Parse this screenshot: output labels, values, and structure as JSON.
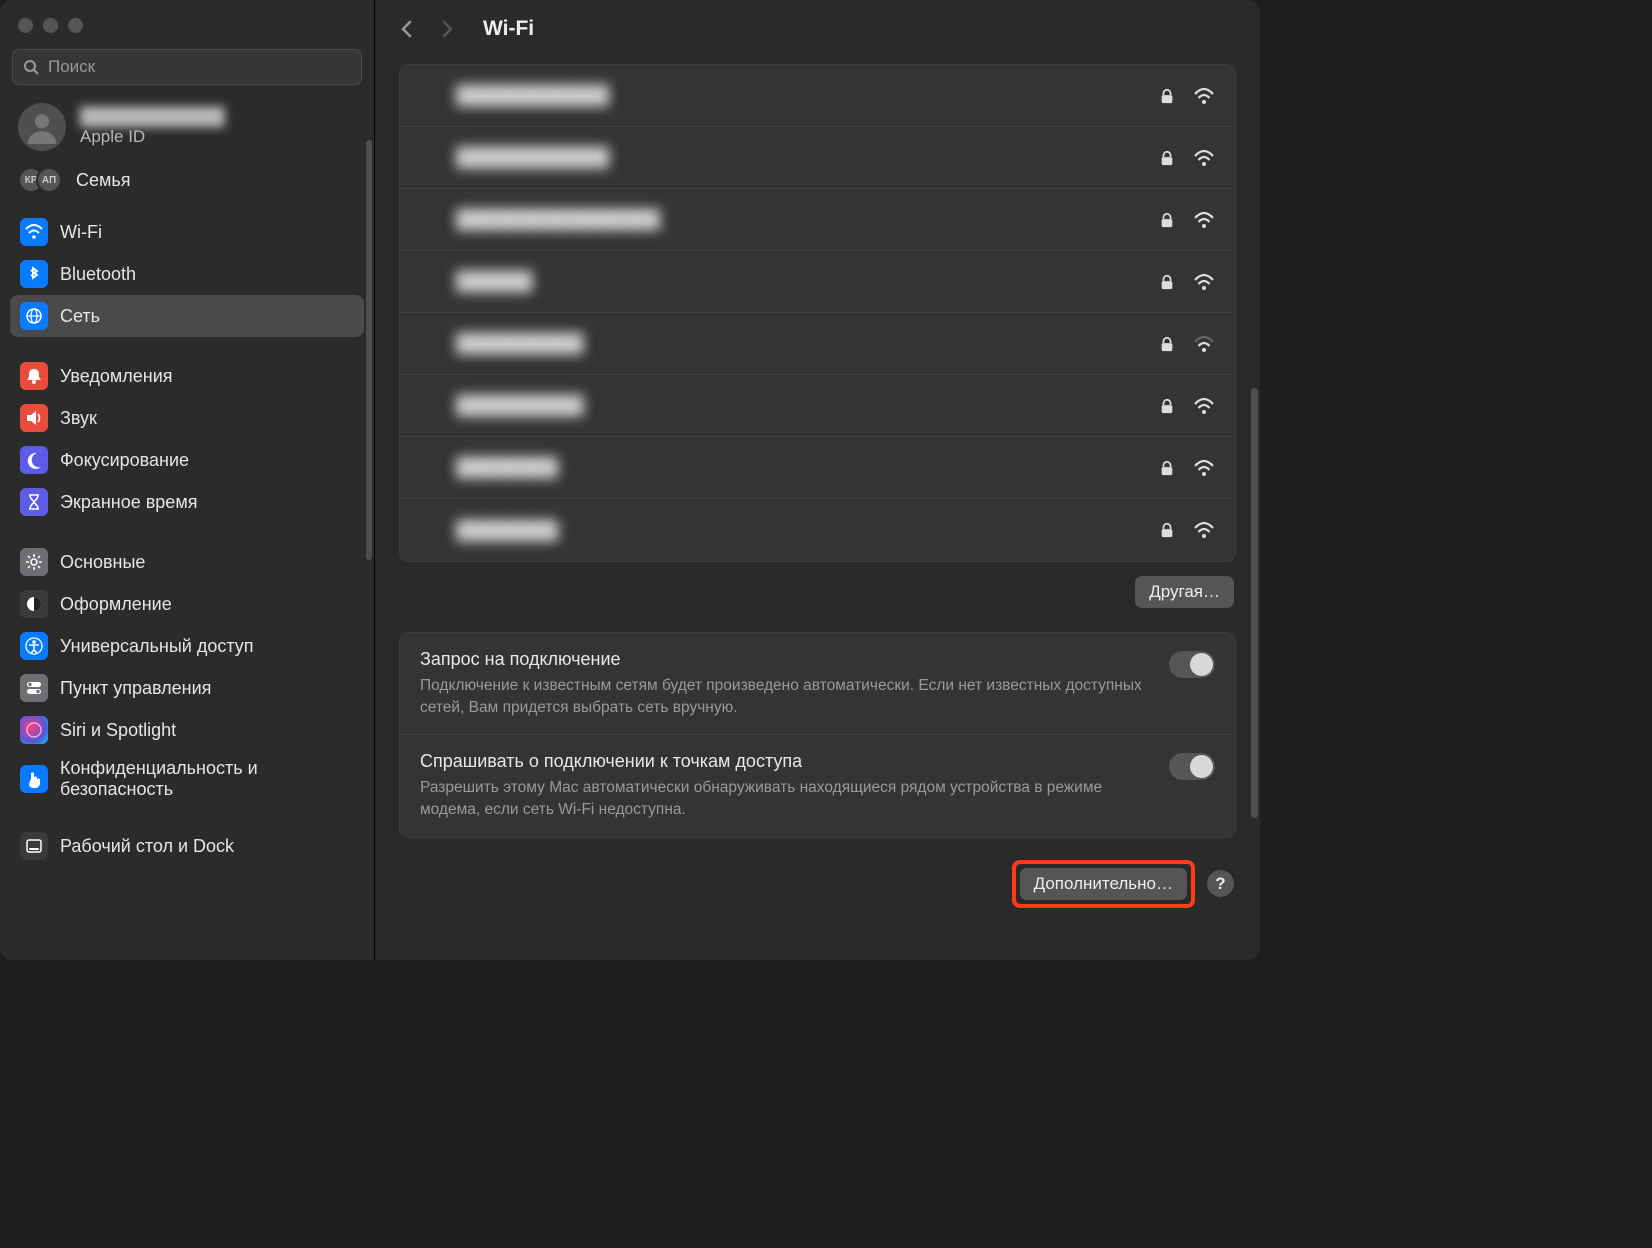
{
  "traffic_lights": [
    "close",
    "minimize",
    "zoom"
  ],
  "search": {
    "placeholder": "Поиск"
  },
  "account": {
    "name": "████████████",
    "sub": "Apple ID"
  },
  "family": {
    "badges": [
      "КР",
      "АП"
    ],
    "label": "Семья"
  },
  "sidebar": {
    "group1": [
      {
        "id": "wifi",
        "label": "Wi-Fi",
        "icon": "wifi",
        "color": "ic-blue"
      },
      {
        "id": "bluetooth",
        "label": "Bluetooth",
        "icon": "bluetooth",
        "color": "ic-blue"
      },
      {
        "id": "network",
        "label": "Сеть",
        "icon": "globe",
        "color": "ic-blue",
        "selected": true
      }
    ],
    "group2": [
      {
        "id": "notifications",
        "label": "Уведомления",
        "icon": "bell",
        "color": "ic-red"
      },
      {
        "id": "sound",
        "label": "Звук",
        "icon": "speaker",
        "color": "ic-red"
      },
      {
        "id": "focus",
        "label": "Фокусирование",
        "icon": "moon",
        "color": "ic-purple"
      },
      {
        "id": "screentime",
        "label": "Экранное время",
        "icon": "hourglass",
        "color": "ic-purple"
      }
    ],
    "group3": [
      {
        "id": "general",
        "label": "Основные",
        "icon": "gear",
        "color": "ic-gray"
      },
      {
        "id": "appearance",
        "label": "Оформление",
        "icon": "appearance",
        "color": "ic-dark"
      },
      {
        "id": "accessibility",
        "label": "Универсальный доступ",
        "icon": "accessibility",
        "color": "ic-cyan"
      },
      {
        "id": "controlcenter",
        "label": "Пункт управления",
        "icon": "switches",
        "color": "ic-gray"
      },
      {
        "id": "siri",
        "label": "Siri и Spotlight",
        "icon": "siri",
        "color": "ic-siri"
      },
      {
        "id": "privacy",
        "label": "Конфиденциальность и безопасность",
        "icon": "hand",
        "color": "ic-cyan"
      }
    ],
    "group4": [
      {
        "id": "desktop",
        "label": "Рабочий стол и Dock",
        "icon": "dock",
        "color": "ic-dark"
      }
    ]
  },
  "header": {
    "title": "Wi-Fi"
  },
  "networks": [
    {
      "name": "████████████",
      "locked": true,
      "signal": 3
    },
    {
      "name": "████████████",
      "locked": true,
      "signal": 3
    },
    {
      "name": "████████████████",
      "locked": true,
      "signal": 3
    },
    {
      "name": "██████",
      "locked": true,
      "signal": 3
    },
    {
      "name": "██████████",
      "locked": true,
      "signal": 2
    },
    {
      "name": "██████████",
      "locked": true,
      "signal": 3
    },
    {
      "name": "████████",
      "locked": true,
      "signal": 3
    },
    {
      "name": "████████",
      "locked": true,
      "signal": 3
    }
  ],
  "buttons": {
    "other": "Другая…",
    "advanced": "Дополнительно…",
    "help": "?"
  },
  "options": [
    {
      "id": "ask-to-join",
      "title": "Запрос на подключение",
      "desc": "Подключение к известным сетям будет произведено автоматически. Если нет известных доступных сетей, Вам придется выбрать сеть вручную.",
      "on": true
    },
    {
      "id": "hotspot",
      "title": "Спрашивать о подключении к точкам доступа",
      "desc": "Разрешить этому Mac автоматически обнаруживать находящиеся рядом устройства в режиме модема, если сеть Wi-Fi недоступна.",
      "on": true
    }
  ]
}
